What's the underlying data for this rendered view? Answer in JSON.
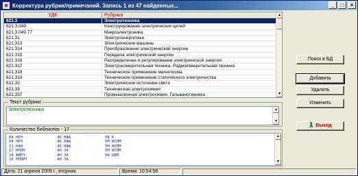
{
  "window": {
    "title": "Корректура рубрик/примечаний. Запись 1 из 47 найденных...",
    "minimize": "_",
    "maximize": "□",
    "close": "×"
  },
  "table": {
    "headers": {
      "code": "УДК",
      "name": "Рубрика"
    },
    "rows": [
      {
        "code": "621.3",
        "name": "Электротехника",
        "selected": true
      },
      {
        "code": "621.3.049",
        "name": "Конструирование электрических цепей"
      },
      {
        "code": "621.3.049.77",
        "name": "Микроэлектроника"
      },
      {
        "code": "621.31",
        "name": "Электроэнергетика"
      },
      {
        "code": "621.313",
        "name": "Электрические машины"
      },
      {
        "code": "621.314",
        "name": "Преобразование электрической энергии"
      },
      {
        "code": "621.315",
        "name": "Передача электрической энергии"
      },
      {
        "code": "621.316",
        "name": "Распределение и регулирование электрической энергии"
      },
      {
        "code": "621.317",
        "name": "Электроизмерительная техника. Радиоизмерительная техника"
      },
      {
        "code": "621.318",
        "name": "Техническое применение магнетизма"
      },
      {
        "code": "621.319",
        "name": "Техническое применение статического электричества"
      },
      {
        "code": "621.32",
        "name": "Электрические источники света"
      },
      {
        "code": "621.35",
        "name": "Техническая электрохимия"
      },
      {
        "code": "621.357",
        "name": "Промышленная электрохимия. Гальванотехника"
      }
    ]
  },
  "text_group": {
    "title": "Текст рубрики",
    "value": "Электротехника"
  },
  "lib_group": {
    "title": "Количество библиотек - 17",
    "rows": [
      [
        "08 НРЭ",
        "4D НФА",
        "5B К"
      ],
      [
        "08 НРЭ",
        "4D НФА",
        "5M ИСПМ"
      ],
      [
        "11 НАН",
        "4D НФА",
        "5M ИСПМ"
      ],
      [
        "17 НПЛН",
        "4H ЗА",
        "5M ИСПМ"
      ],
      [
        "18 ФИРЭ",
        "4H ЗА",
        "8A ЦВП"
      ],
      [
        "1K НПЛИТ",
        "4H ЗА",
        ""
      ]
    ]
  },
  "buttons": {
    "search": "Поиск в БД",
    "add": "Добавить",
    "delete": "Удалить",
    "edit": "Изменить",
    "exit": "Выход"
  },
  "status": {
    "date": "Дата: 21 апреля 2009 г., вторник",
    "time": "Время: 10:54:58"
  }
}
